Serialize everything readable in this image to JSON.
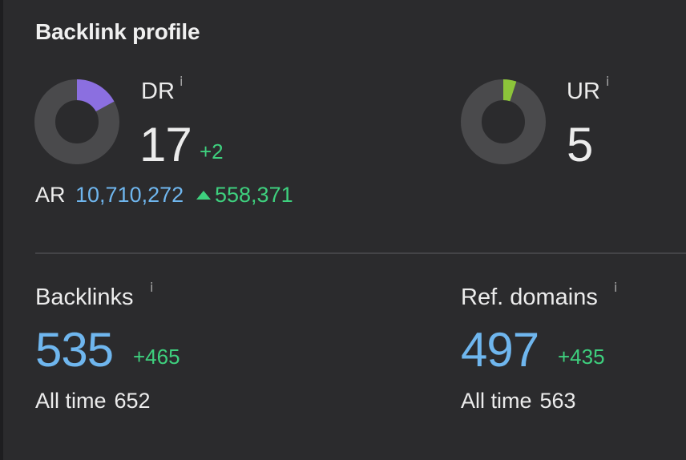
{
  "widget": {
    "title": "Backlink profile"
  },
  "dr": {
    "label": "DR",
    "value": "17",
    "delta": "+2",
    "ring_fraction": 0.17,
    "ring_color": "#8b6fe0"
  },
  "ur": {
    "label": "UR",
    "value": "5",
    "ring_fraction": 0.05,
    "ring_color": "#8cc43a"
  },
  "ar": {
    "label": "AR",
    "value": "10,710,272",
    "delta": "558,371"
  },
  "backlinks": {
    "label": "Backlinks",
    "value": "535",
    "delta": "+465",
    "alltime_label": "All time",
    "alltime_value": "652"
  },
  "ref_domains": {
    "label": "Ref. domains",
    "value": "497",
    "delta": "+435",
    "alltime_label": "All time",
    "alltime_value": "563"
  },
  "colors": {
    "background": "#2b2b2d",
    "accent_blue": "#6fb6ee",
    "positive_green": "#3ed07e",
    "ring_track": "#4a4a4c"
  },
  "info_icon": "i"
}
